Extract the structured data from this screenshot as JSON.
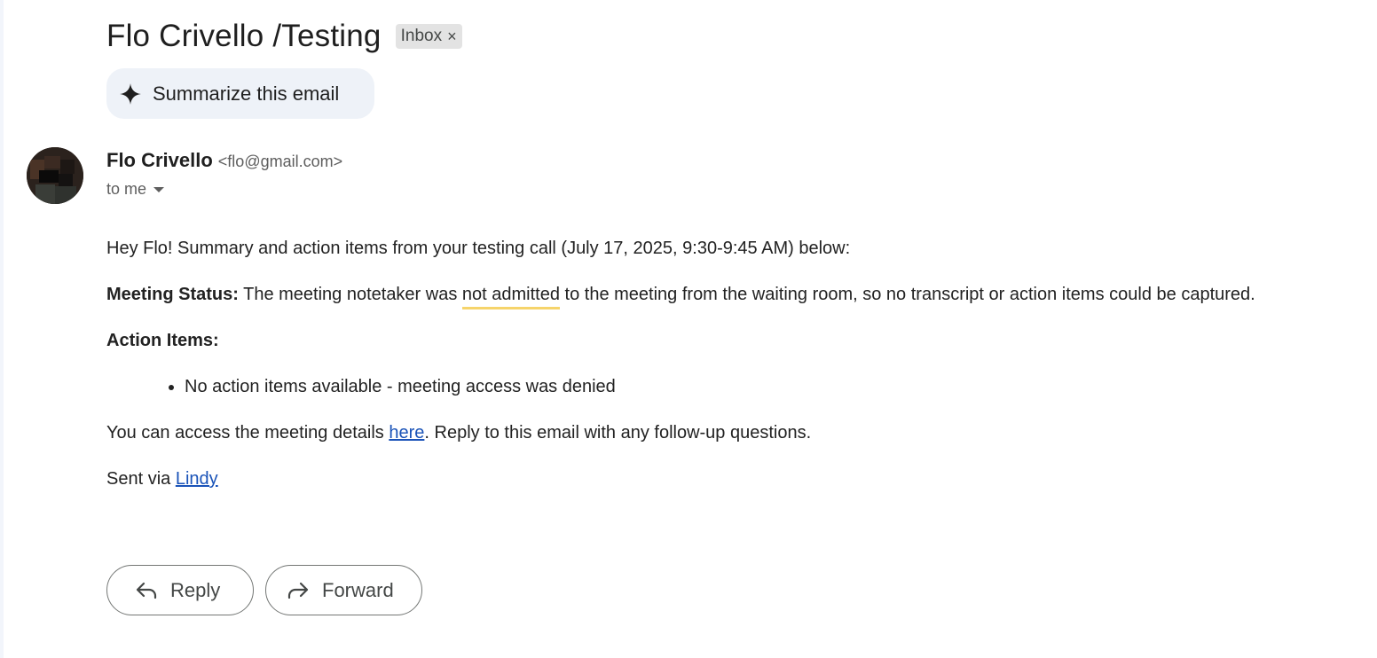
{
  "email": {
    "subject": "Flo Crivello /Testing",
    "label_chip": {
      "text": "Inbox",
      "close_glyph": "×"
    },
    "summarize_button": {
      "label": "Summarize this email",
      "icon": "sparkle-icon"
    },
    "sender": {
      "name": "Flo Crivello",
      "email": "<flo@gmail.com>",
      "recipient": "to me",
      "avatar": "avatar"
    },
    "body": {
      "greeting": "Hey Flo! Summary and action items from your testing call (July 17, 2025, 9:30-9:45 AM) below:",
      "meeting_status_label": "Meeting Status:",
      "meeting_status_text_1": " The meeting notetaker was ",
      "meeting_status_highlight": "not admitted",
      "meeting_status_text_2": " to the meeting from the waiting room, so no transcript or action items could be captured.",
      "action_items_label": "Action Items:",
      "action_items": [
        "No action items available - meeting access was denied"
      ],
      "access_text_1": "You can access the meeting details ",
      "access_link": "here",
      "access_text_2": ". Reply to this email with any follow-up questions.",
      "sent_via_text": "Sent via ",
      "sent_via_link": "Lindy"
    },
    "actions": {
      "reply_label": "Reply",
      "forward_label": "Forward"
    }
  },
  "colors": {
    "link": "#1a53b8",
    "highlight_underline": "#f6d46b",
    "chip_bg": "#e3e3e3",
    "summarize_bg": "#eef2f8",
    "button_border": "#747775"
  }
}
